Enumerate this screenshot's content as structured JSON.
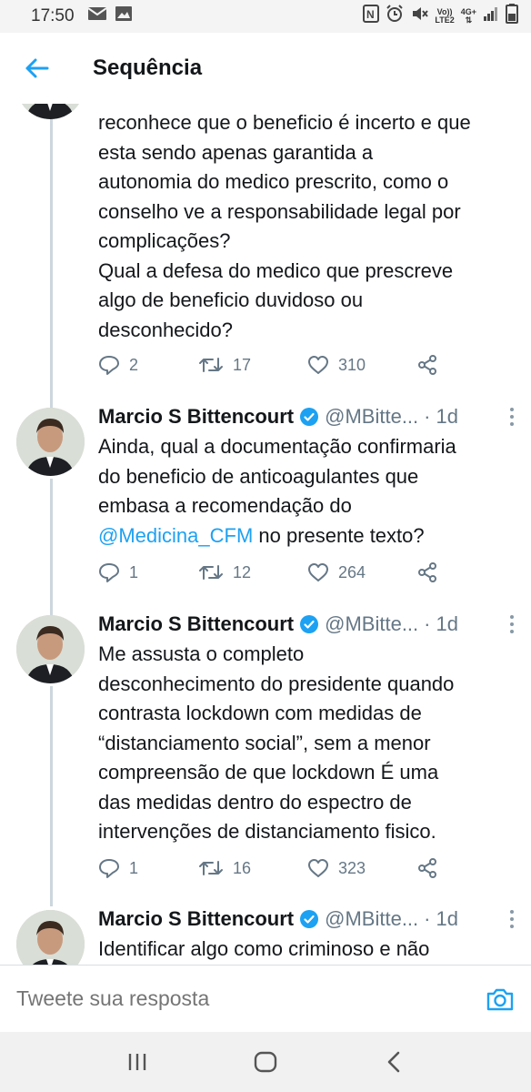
{
  "status_bar": {
    "time": "17:50",
    "lte_label_top": "Vo))",
    "lte_label_bottom": "LTE2",
    "net_label": "4G+",
    "icons": [
      "mail-icon",
      "image-icon",
      "nfc-icon",
      "alarm-icon",
      "mute-icon",
      "signal-icon",
      "battery-icon"
    ]
  },
  "header": {
    "title": "Sequência",
    "back_icon": "arrow-left-icon"
  },
  "tweets": [
    {
      "text_lines": [
        "reconhece que o beneficio é incerto e que",
        "esta sendo apenas garantida a",
        "autonomia do medico prescrito, como o",
        "conselho ve a responsabilidade legal por",
        "complicações?",
        "Qual a defesa do medico que prescreve",
        "algo de beneficio duvidoso ou",
        "desconhecido?"
      ],
      "replies": "2",
      "retweets": "17",
      "likes": "310"
    },
    {
      "name": "Marcio S Bittencourt",
      "handle": "@MBitte...",
      "time": "1d",
      "text_lines": [
        "Ainda, qual a documentação confirmaria",
        "do beneficio de anticoagulantes que",
        "embasa a recomendação do"
      ],
      "mention": "@Medicina_CFM",
      "mention_tail": " no presente texto?",
      "replies": "1",
      "retweets": "12",
      "likes": "264"
    },
    {
      "name": "Marcio S Bittencourt",
      "handle": "@MBitte...",
      "time": "1d",
      "text_lines": [
        "Me assusta o completo",
        "desconhecimento do presidente quando",
        "contrasta lockdown com medidas de",
        "“distanciamento social”, sem a menor",
        "compreensão de que lockdown É uma",
        "das medidas dentro do espectro de",
        "intervenções de distanciamento fisico."
      ],
      "replies": "1",
      "retweets": "16",
      "likes": "323"
    },
    {
      "name": "Marcio S Bittencourt",
      "handle": "@MBitte...",
      "time": "1d",
      "text_lines": [
        "Identificar algo como criminoso e não"
      ]
    }
  ],
  "reply_bar": {
    "placeholder": "Tweete sua resposta",
    "camera_icon": "camera-icon"
  },
  "nav_bar": {
    "icons": [
      "recent-apps-icon",
      "home-icon",
      "back-icon"
    ]
  },
  "colors": {
    "accent": "#1da1f2",
    "text": "#14171a",
    "secondary": "#657786",
    "thread_line": "#ccd6dd"
  }
}
